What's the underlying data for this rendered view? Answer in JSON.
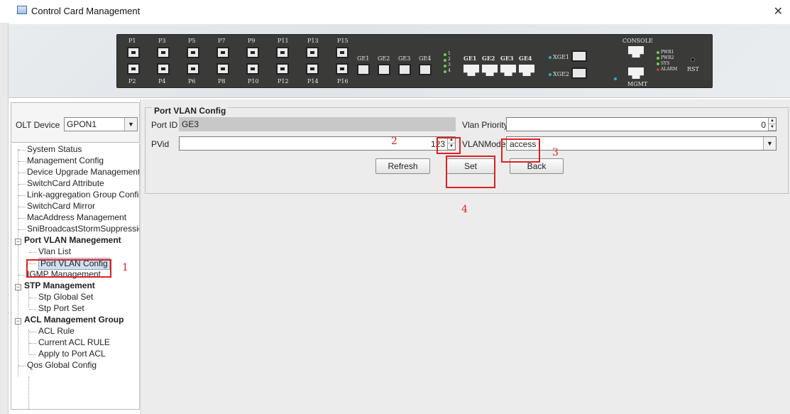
{
  "window": {
    "title": "Control Card Management",
    "close_glyph": "✕"
  },
  "device_panel": {
    "top_port_labels": [
      "P1",
      "P3",
      "P5",
      "P7",
      "P9",
      "P11",
      "P13",
      "P15"
    ],
    "bottom_port_labels": [
      "P2",
      "P4",
      "P6",
      "P8",
      "P10",
      "P12",
      "P14",
      "P16"
    ],
    "ge_labels": [
      "GE1",
      "GE2",
      "GE3",
      "GE4"
    ],
    "ge_led_labels": [
      "1",
      "2",
      "3",
      "4"
    ],
    "rj45_labels": [
      "GE1",
      "GE2",
      "GE3",
      "GE4"
    ],
    "xge_labels": [
      "XGE1",
      "XGE2"
    ],
    "console_label": "CONSOLE",
    "mgmt_label": "MGMT",
    "status_leds": [
      "PWR1",
      "PWR2",
      "SYS",
      "ALARM"
    ],
    "rst_label": "RST"
  },
  "sidebar": {
    "olt_label": "OLT Device",
    "olt_value": "GPON1",
    "tree": {
      "system_status": "System Status",
      "management_config": "Management Config",
      "device_upgrade": "Device Upgrade Management",
      "switchcard_attr": "SwitchCard Attribute",
      "link_aggregation": "Link-aggregation Group Config",
      "switchcard_mirror": "SwitchCard Mirror",
      "macaddress": "MacAddress Management",
      "sni_broadcast": "SniBroadcastStormSuppressio",
      "port_vlan_group": "Port VLAN Manegement",
      "vlan_list": "Vlan List",
      "port_vlan_config": "Port VLAN Config",
      "igmp": "IGMP Management",
      "stp_group": "STP Management",
      "stp_global": "Stp Global Set",
      "stp_port": "Stp Port Set",
      "acl_group": "ACL Management Group",
      "acl_rule": "ACL Rule",
      "current_acl": "Current ACL RULE",
      "apply_acl": "Apply to Port ACL",
      "qos": "Qos Global Config"
    }
  },
  "form": {
    "legend": "Port VLAN Config",
    "port_id_label": "Port ID",
    "port_id_value": "GE3",
    "vlan_priority_label": "Vlan Priority",
    "vlan_priority_value": "0",
    "pvid_label": "PVid",
    "pvid_value": "123",
    "vlanmode_label": "VLANMode",
    "vlanmode_value": "access",
    "refresh_label": "Refresh",
    "set_label": "Set",
    "back_label": "Back"
  },
  "annotations": {
    "n1": "1",
    "n2": "2",
    "n3": "3",
    "n4": "4",
    "color": "#e02020"
  }
}
